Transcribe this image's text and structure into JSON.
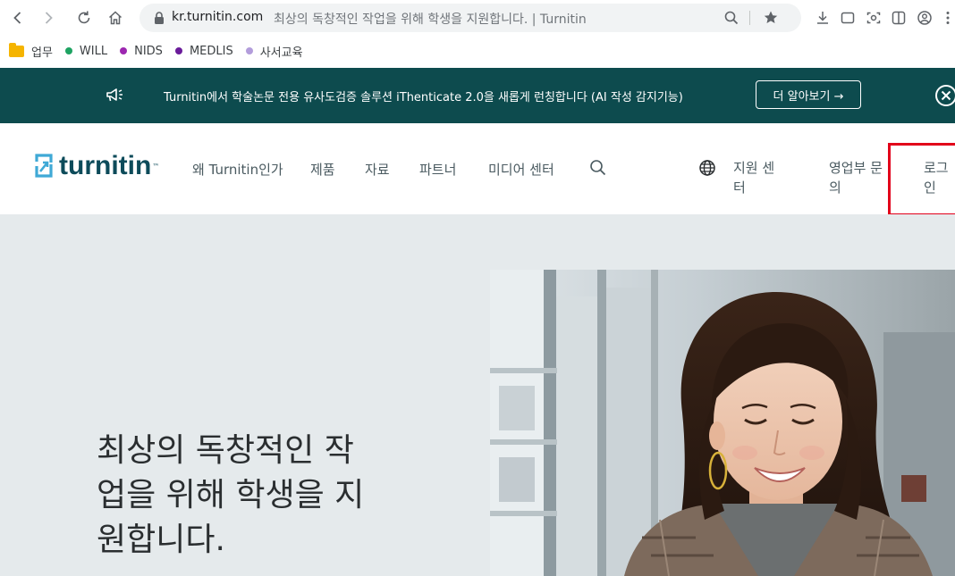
{
  "browser": {
    "url_domain": "kr.turnitin.com",
    "page_title": "최상의 독창적인 작업을 위해 학생을 지원합니다. | Turnitin",
    "bookmarks": [
      {
        "label": "업무",
        "icon": "folder-icon",
        "color": "#f5b400"
      },
      {
        "label": "WILL",
        "icon": "dot-icon",
        "color": "#1ea362"
      },
      {
        "label": "NIDS",
        "icon": "dot-icon",
        "color": "#9c27b0"
      },
      {
        "label": "MEDLIS",
        "icon": "dot-icon",
        "color": "#6a1b9a"
      },
      {
        "label": "사서교육",
        "icon": "dot-icon",
        "color": "#b39ddb"
      }
    ]
  },
  "banner": {
    "text": "Turnitin에서 학술논문 전용 유사도검증 솔루션 iThenticate 2.0을 새롭게 런칭합니다 (AI 작성 감지기능)",
    "cta_label": "더 알아보기 →",
    "background": "#0d4b4e"
  },
  "nav": {
    "logo_text": "turnitin",
    "logo_tm": "™",
    "items": [
      "왜 Turnitin인가",
      "제품",
      "자료",
      "파트너",
      "미디어 센터"
    ],
    "support_line1": "지원 센",
    "support_line2": "터",
    "sales_line1": "영업부 문",
    "sales_line2": "의",
    "login_line1": "로그",
    "login_line2": "인",
    "highlight_color": "#e2001a"
  },
  "hero": {
    "title_line1": "최상의 독창적인 작",
    "title_line2": "업을 위해 학생을 지",
    "title_line3": "원합니다."
  }
}
